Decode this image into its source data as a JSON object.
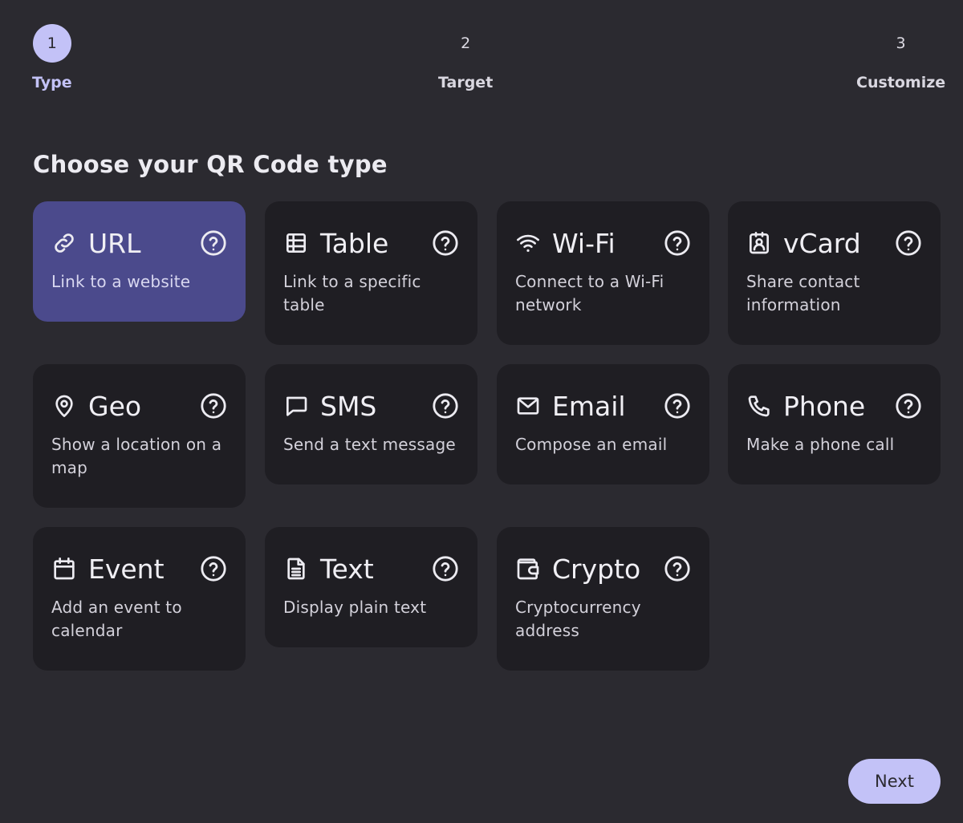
{
  "steps": [
    {
      "number": "1",
      "label": "Type"
    },
    {
      "number": "2",
      "label": "Target"
    },
    {
      "number": "3",
      "label": "Customize"
    }
  ],
  "section_title": "Choose your QR Code type",
  "cards": [
    {
      "title": "URL",
      "desc": "Link to a website",
      "icon": "link-icon"
    },
    {
      "title": "Table",
      "desc": "Link to a specific table",
      "icon": "table-icon"
    },
    {
      "title": "Wi-Fi",
      "desc": "Connect to a Wi-Fi network",
      "icon": "wifi-icon"
    },
    {
      "title": "vCard",
      "desc": "Share contact information",
      "icon": "contact-card-icon"
    },
    {
      "title": "Geo",
      "desc": "Show a location on a map",
      "icon": "map-pin-icon"
    },
    {
      "title": "SMS",
      "desc": "Send a text message",
      "icon": "message-icon"
    },
    {
      "title": "Email",
      "desc": "Compose an email",
      "icon": "mail-icon"
    },
    {
      "title": "Phone",
      "desc": "Make a phone call",
      "icon": "phone-icon"
    },
    {
      "title": "Event",
      "desc": "Add an event to calendar",
      "icon": "calendar-icon"
    },
    {
      "title": "Text",
      "desc": "Display plain text",
      "icon": "document-icon"
    },
    {
      "title": "Crypto",
      "desc": "Cryptocurrency address",
      "icon": "wallet-icon"
    }
  ],
  "selected_card": "URL",
  "next_label": "Next",
  "colors": {
    "background": "#2b2a30",
    "card": "#1f1e23",
    "selected_card": "#4b4a8c",
    "accent": "#c3c2f7"
  }
}
